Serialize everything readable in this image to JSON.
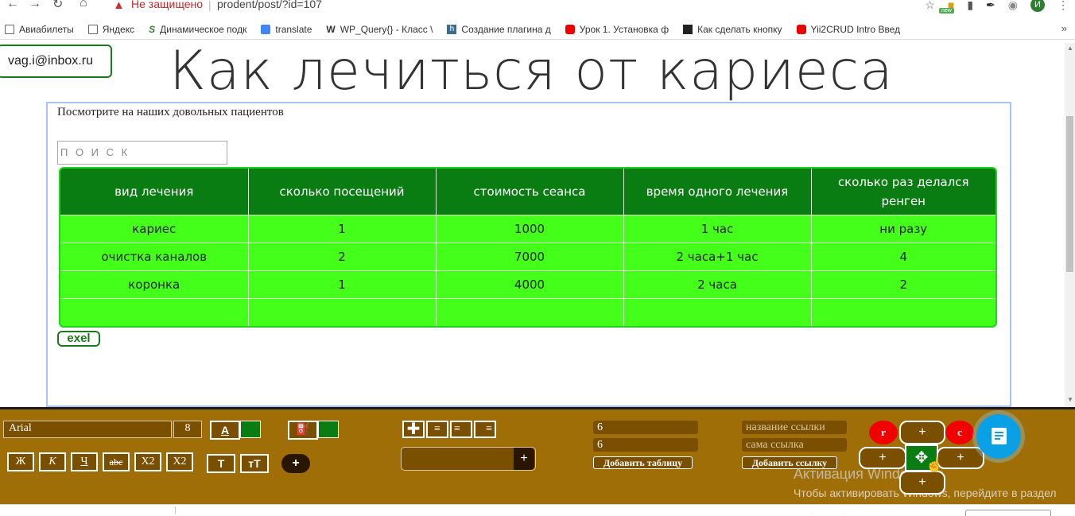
{
  "browser": {
    "security_label": "Не защищено",
    "url": "prodent/post/?id=107",
    "profile_initial": "И",
    "ext_badge": "new"
  },
  "bookmarks": [
    {
      "label": "Авиабилеты",
      "icon": "page-icon"
    },
    {
      "label": "Яндекс",
      "icon": "page-icon"
    },
    {
      "label": "Динамическое подк",
      "icon": "s-logo-icon"
    },
    {
      "label": "translate",
      "icon": "translate-icon"
    },
    {
      "label": "WP_Query{} - Класс \\",
      "icon": "wp-icon"
    },
    {
      "label": "Создание плагина д",
      "icon": "h-icon"
    },
    {
      "label": "Урок 1. Установка ф",
      "icon": "youtube-icon"
    },
    {
      "label": "Как сделать кнопку",
      "icon": "html-icon"
    },
    {
      "label": "Yii2CRUD Intro Введ",
      "icon": "youtube-icon"
    }
  ],
  "page": {
    "email": "vag.i@inbox.ru",
    "title": "Как лечиться от кариеса",
    "subtitle": "Посмотрите на наших довольных пациентов",
    "search_placeholder": "П О И С К",
    "exel_label": "exel"
  },
  "table": {
    "headers": [
      "вид лечения",
      "сколько посещений",
      "стоимость сеанса",
      "время одного лечения",
      "сколько раз делался ренген"
    ],
    "rows": [
      [
        "кариес",
        "1",
        "1000",
        "1 час",
        "ни разу"
      ],
      [
        "очистка каналов",
        "2",
        "7000",
        "2 часа+1 час",
        "4"
      ],
      [
        "коронка",
        "1",
        "4000",
        "2 часа",
        "2"
      ],
      [
        "",
        "",
        "",
        "",
        ""
      ]
    ]
  },
  "editor": {
    "font_name": "Arial",
    "font_size": "8",
    "text_color_label": "A",
    "text_color": "#0a7d12",
    "fill_color": "#0a7d12",
    "format_buttons": [
      "Ж",
      "К",
      "Ч",
      "abc",
      "X2",
      "X2"
    ],
    "case_buttons": [
      "T",
      "тT"
    ],
    "add_label": "+",
    "rows_value": "6",
    "cols_value": "6",
    "add_table_label": "Добавить таблицу",
    "link_name_placeholder": "название ссылки",
    "link_url_placeholder": "сама ссылка",
    "add_link_label": "Добавить ссылку",
    "r_label": "r",
    "c_label": "c",
    "plus": "+"
  },
  "windows_watermark": {
    "title": "Активация Windows",
    "text": "Чтобы активировать Windows, перейдите в раздел \"Параметры\"."
  }
}
